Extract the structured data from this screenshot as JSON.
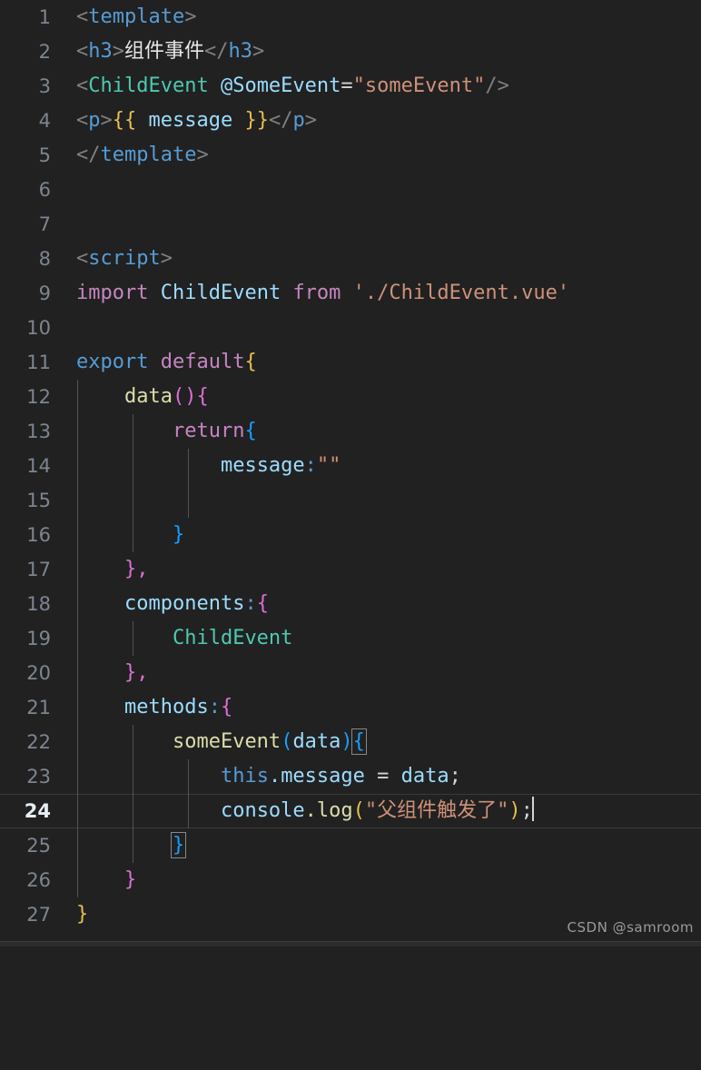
{
  "editor": {
    "title": "Vue SFC code editor",
    "language": "vue",
    "theme": "Dark+",
    "total_lines": 27,
    "active_line": 24,
    "background_color": "#212121",
    "line_number_color": "#7d8590",
    "active_line_number_color": "#e6edf3"
  },
  "watermark": {
    "text": "CSDN @samroom"
  },
  "lines": [
    {
      "n": "1",
      "text": "<template>"
    },
    {
      "n": "2",
      "text": "<h3>组件事件</h3>"
    },
    {
      "n": "3",
      "text": "<ChildEvent @SomeEvent=\"someEvent\"/>"
    },
    {
      "n": "4",
      "text": "<p>{{ message }}</p>"
    },
    {
      "n": "5",
      "text": "</template>"
    },
    {
      "n": "6",
      "text": ""
    },
    {
      "n": "7",
      "text": ""
    },
    {
      "n": "8",
      "text": "<script>"
    },
    {
      "n": "9",
      "text": "import ChildEvent from './ChildEvent.vue'"
    },
    {
      "n": "10",
      "text": ""
    },
    {
      "n": "11",
      "text": "export default{"
    },
    {
      "n": "12",
      "text": "    data(){"
    },
    {
      "n": "13",
      "text": "        return{"
    },
    {
      "n": "14",
      "text": "            message:\"\""
    },
    {
      "n": "15",
      "text": ""
    },
    {
      "n": "16",
      "text": "        }"
    },
    {
      "n": "17",
      "text": "    },"
    },
    {
      "n": "18",
      "text": "    components:{"
    },
    {
      "n": "19",
      "text": "        ChildEvent"
    },
    {
      "n": "20",
      "text": "    },"
    },
    {
      "n": "21",
      "text": "    methods:{"
    },
    {
      "n": "22",
      "text": "        someEvent(data){"
    },
    {
      "n": "23",
      "text": "            this.message = data;"
    },
    {
      "n": "24",
      "text": "            console.log(\"父组件触发了\");"
    },
    {
      "n": "25",
      "text": "        }"
    },
    {
      "n": "26",
      "text": "    }"
    },
    {
      "n": "27",
      "text": "}"
    }
  ],
  "tokens": {
    "l1": {
      "open": "<",
      "name": "template",
      "close": ">"
    },
    "l2": {
      "open": "<",
      "tag": "h3",
      "gt": ">",
      "text": "组件事件",
      "closeopen": "</",
      "closetag": "h3",
      "closegt": ">"
    },
    "l3": {
      "open": "<",
      "comp": "ChildEvent",
      "space": " ",
      "attr": "@SomeEvent",
      "eq": "=",
      "value": "\"someEvent\"",
      "selfclose": "/>"
    },
    "l4": {
      "open": "<",
      "tag": "p",
      "gt": ">",
      "braceopen": "{{",
      "expr": " message ",
      "braceclose": "}}",
      "closeopen": "</",
      "closetag": "p",
      "closegt": ">"
    },
    "l5": {
      "open": "</",
      "name": "template",
      "close": ">"
    },
    "l8": {
      "open": "<",
      "name": "script",
      "close": ">"
    },
    "l9": {
      "kw_import": "import",
      "module": "ChildEvent",
      "kw_from": "from",
      "path": "'./ChildEvent.vue'"
    },
    "l11": {
      "kw_export": "export",
      "kw_default": "default",
      "brace": "{"
    },
    "l12": {
      "indent": "    ",
      "fn": "data",
      "parens": "()",
      "brace": "{"
    },
    "l13": {
      "indent": "        ",
      "kw_return": "return",
      "brace": "{"
    },
    "l14": {
      "indent": "            ",
      "prop": "message",
      "colon": ":",
      "value": "\"\""
    },
    "l16": {
      "indent": "        ",
      "brace": "}"
    },
    "l17": {
      "indent": "    ",
      "brace": "}",
      "comma": ","
    },
    "l18": {
      "indent": "    ",
      "prop": "components",
      "colon": ":",
      "brace": "{"
    },
    "l19": {
      "indent": "        ",
      "comp": "ChildEvent"
    },
    "l20": {
      "indent": "    ",
      "brace": "}",
      "comma": ","
    },
    "l21": {
      "indent": "    ",
      "prop": "methods",
      "colon": ":",
      "brace": "{"
    },
    "l22": {
      "indent": "        ",
      "fn": "someEvent",
      "paren_open": "(",
      "param": "data",
      "paren_close": ")",
      "brace": "{"
    },
    "l23": {
      "indent": "            ",
      "this": "this",
      "dot": ".",
      "prop": "message",
      "op": " = ",
      "param": "data",
      "semi": ";"
    },
    "l24": {
      "indent": "            ",
      "obj": "console",
      "dot": ".",
      "method": "log",
      "paren_open": "(",
      "string": "\"父组件触发了\"",
      "paren_close": ")",
      "semi": ";"
    },
    "l25": {
      "indent": "        ",
      "brace": "}"
    },
    "l26": {
      "indent": "    ",
      "brace": "}"
    },
    "l27": {
      "brace": "}"
    }
  },
  "colors": {
    "background": "#212121",
    "tag": "#569cd6",
    "component": "#4ec9b0",
    "attribute": "#9cdcfe",
    "string": "#ce9178",
    "keyword": "#c586c0",
    "function": "#dcdcaa",
    "variable": "#9cdcfe",
    "punctuation": "#808080",
    "brace_yellow": "#e8bf4e",
    "brace_pink": "#da70d6",
    "brace_blue": "#179fff",
    "plain_text": "#d4d4d4"
  }
}
